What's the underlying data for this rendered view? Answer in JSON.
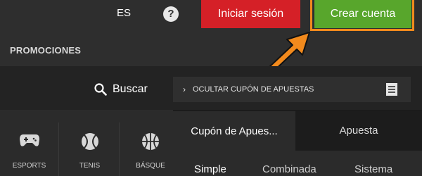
{
  "header": {
    "language": "ES",
    "help_glyph": "?",
    "login_label": "Iniciar sesión",
    "signup_label": "Crear cuenta"
  },
  "promotions": {
    "label": "PROMOCIONES"
  },
  "search": {
    "label": "Buscar"
  },
  "coupon_toggle": {
    "label": "OCULTAR CUPÓN DE APUESTAS"
  },
  "sports": [
    {
      "label": "ESPORTS",
      "icon": "gamepad-icon"
    },
    {
      "label": "TENIS",
      "icon": "tennis-ball-icon"
    },
    {
      "label": "BÁSQUE",
      "icon": "basketball-icon"
    }
  ],
  "betslip": {
    "tabs": [
      "Cupón de Apues...",
      "Apuesta"
    ],
    "subtabs": [
      "Simple",
      "Combinada",
      "Sistema"
    ]
  },
  "colors": {
    "login": "#d52027",
    "signup": "#58a62c",
    "highlight": "#f28a1d"
  }
}
